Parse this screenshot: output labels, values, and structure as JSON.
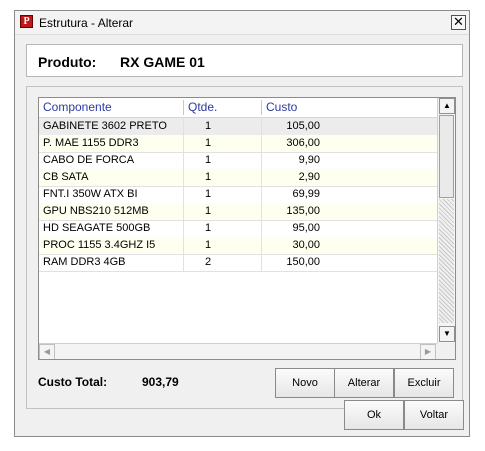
{
  "window": {
    "title": "Estrutura - Alterar",
    "close_glyph": "✕"
  },
  "product": {
    "label": "Produto:",
    "value": "RX GAME 01"
  },
  "grid": {
    "columns": [
      "Componente",
      "Qtde.",
      "Custo"
    ],
    "rows": [
      [
        "GABINETE 3602 PRETO",
        "1",
        "105,00"
      ],
      [
        "P. MAE 1155 DDR3",
        "1",
        "306,00"
      ],
      [
        "CABO DE FORCA",
        "1",
        "9,90"
      ],
      [
        "CB SATA",
        "1",
        "2,90"
      ],
      [
        "FNT.I 350W ATX BI",
        "1",
        "69,99"
      ],
      [
        "GPU NBS210 512MB",
        "1",
        "135,00"
      ],
      [
        "HD SEAGATE 500GB",
        "1",
        "95,00"
      ],
      [
        "PROC 1155 3.4GHZ I5",
        "1",
        "30,00"
      ],
      [
        "RAM DDR3 4GB",
        "2",
        "150,00"
      ]
    ]
  },
  "totals": {
    "label": "Custo Total:",
    "value": "903,79"
  },
  "buttons": {
    "novo": "Novo",
    "alterar": "Alterar",
    "excluir": "Excluir",
    "ok": "Ok",
    "voltar": "Voltar"
  },
  "icons": {
    "app": "app-logo-icon",
    "up": "scroll-up-icon",
    "down": "scroll-down-icon",
    "left": "scroll-left-icon",
    "right": "scroll-right-icon"
  },
  "colors": {
    "header_text": "#2b3ba3",
    "selected_row": "#ececec",
    "alt_row": "#fffff0"
  }
}
